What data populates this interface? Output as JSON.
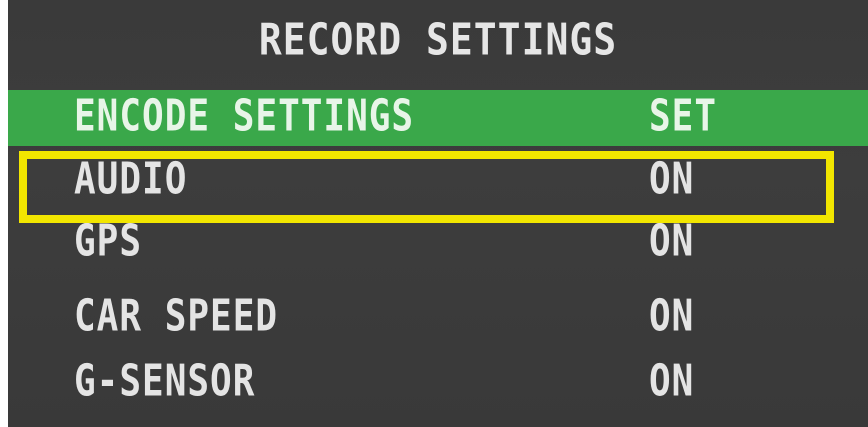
{
  "menu": {
    "title": "RECORD SETTINGS",
    "items": [
      {
        "label": "ENCODE SETTINGS",
        "value": "SET"
      },
      {
        "label": "AUDIO",
        "value": "ON"
      },
      {
        "label": "GPS",
        "value": "ON"
      },
      {
        "label": "CAR SPEED",
        "value": "ON"
      },
      {
        "label": "G-SENSOR",
        "value": "ON"
      }
    ],
    "selected_item": "ENCODE SETTINGS",
    "annotated_item": "AUDIO"
  },
  "colors": {
    "background": "#3b3b3b",
    "selected_row": "#3aa84a",
    "annotation_box": "#f2e600",
    "text": "#e4e4e4"
  }
}
